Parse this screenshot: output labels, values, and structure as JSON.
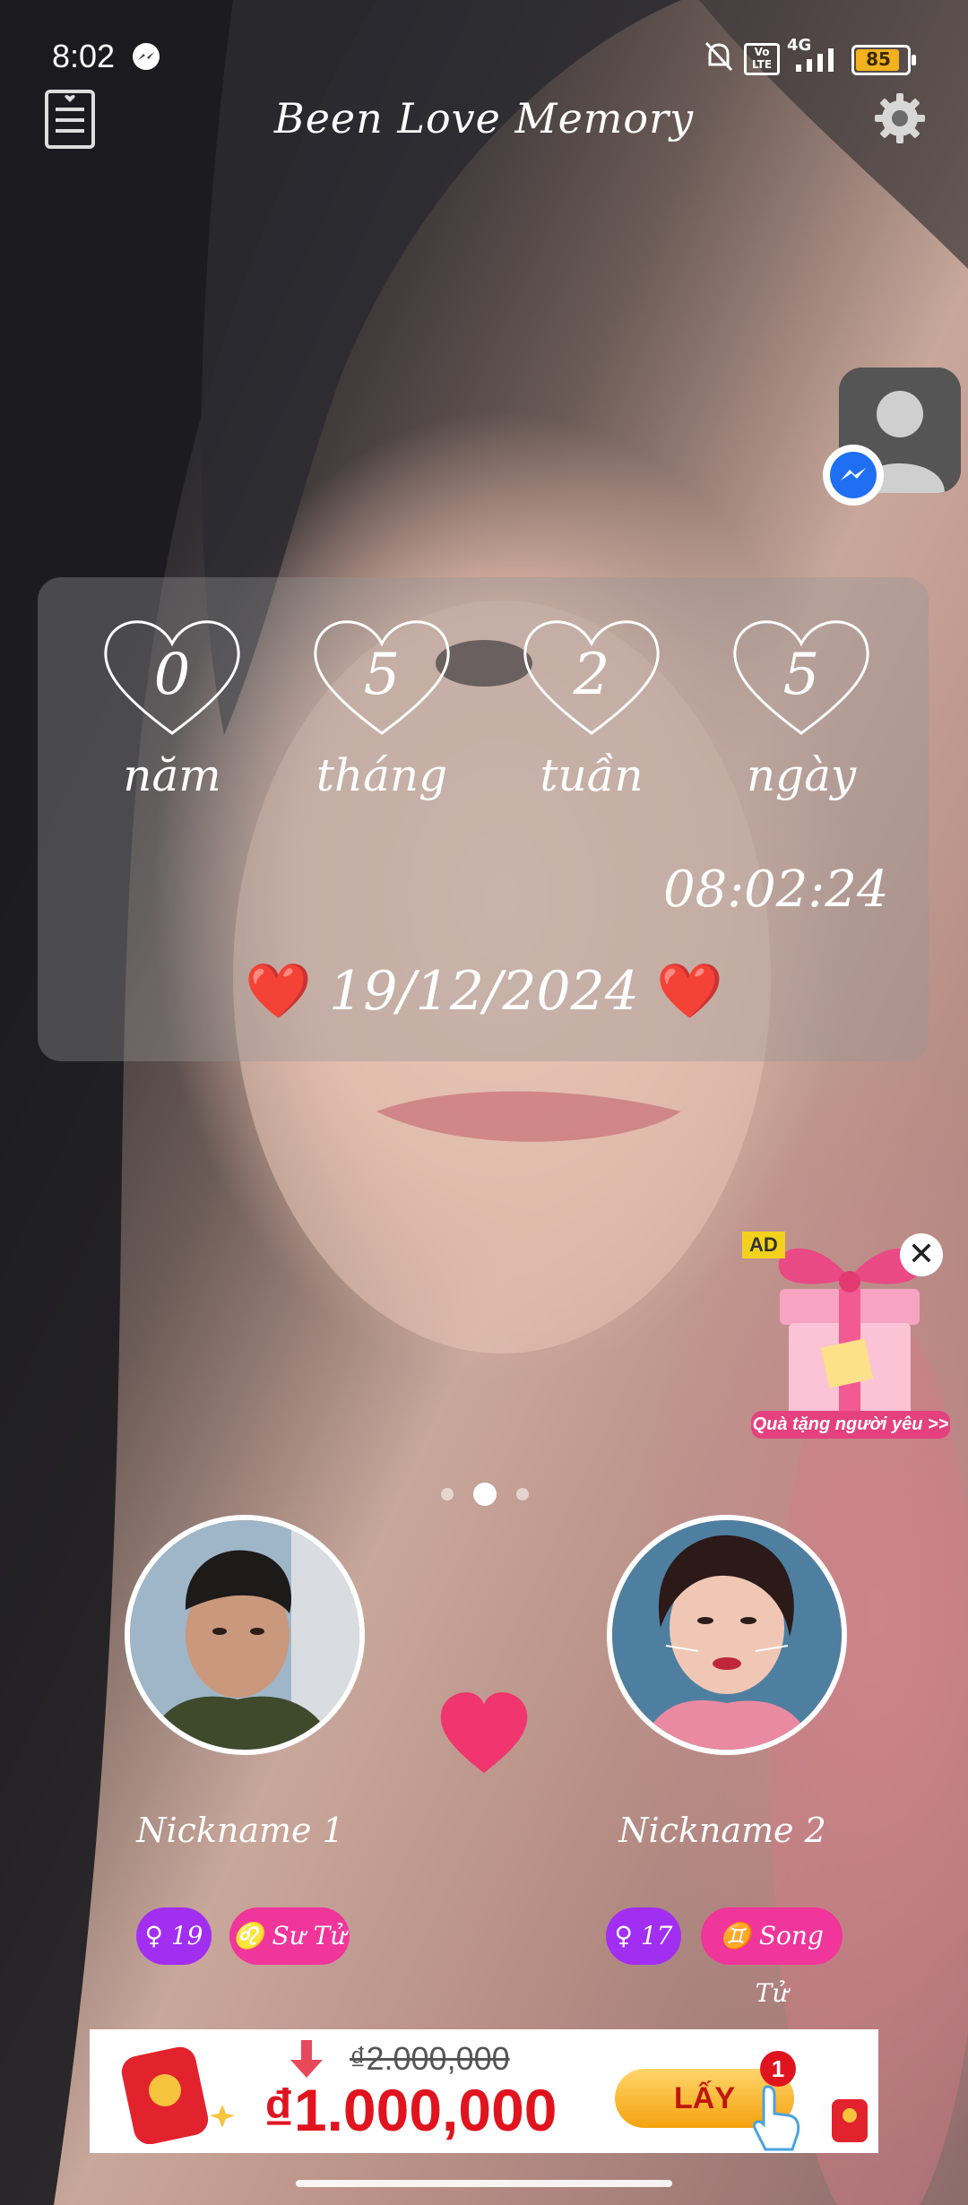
{
  "statusbar": {
    "time": "8:02",
    "network": "4G",
    "battery": "85"
  },
  "header": {
    "title": "Been Love Memory"
  },
  "counter": {
    "items": [
      {
        "value": "0",
        "label": "năm"
      },
      {
        "value": "5",
        "label": "tháng"
      },
      {
        "value": "2",
        "label": "tuần"
      },
      {
        "value": "5",
        "label": "ngày"
      }
    ],
    "clock": "08:02:24",
    "start_date": "19/12/2024",
    "heart_glyph": "❤️"
  },
  "ad_gift": {
    "tag": "AD",
    "close": "✕",
    "caption": "Quà tặng người yêu >>"
  },
  "pager": {
    "count": 3,
    "active": 1
  },
  "person1": {
    "nickname": "Nickname 1",
    "age": "♀ 19",
    "zodiac": "♌ Sư Tử"
  },
  "person2": {
    "nickname": "Nickname 2",
    "age": "♀ 17",
    "zodiac": "♊ Song Tử"
  },
  "banner": {
    "old_price": "₫2.000,000",
    "new_price": "₫1.000,000",
    "button": "LẤY",
    "badge": "1"
  },
  "colors": {
    "heart_pink": "#f0356f",
    "age_pill": "#a22ef2",
    "zodiac_pill": "#f0359b",
    "card_overlay": "rgba(150,150,150,0.38)"
  }
}
